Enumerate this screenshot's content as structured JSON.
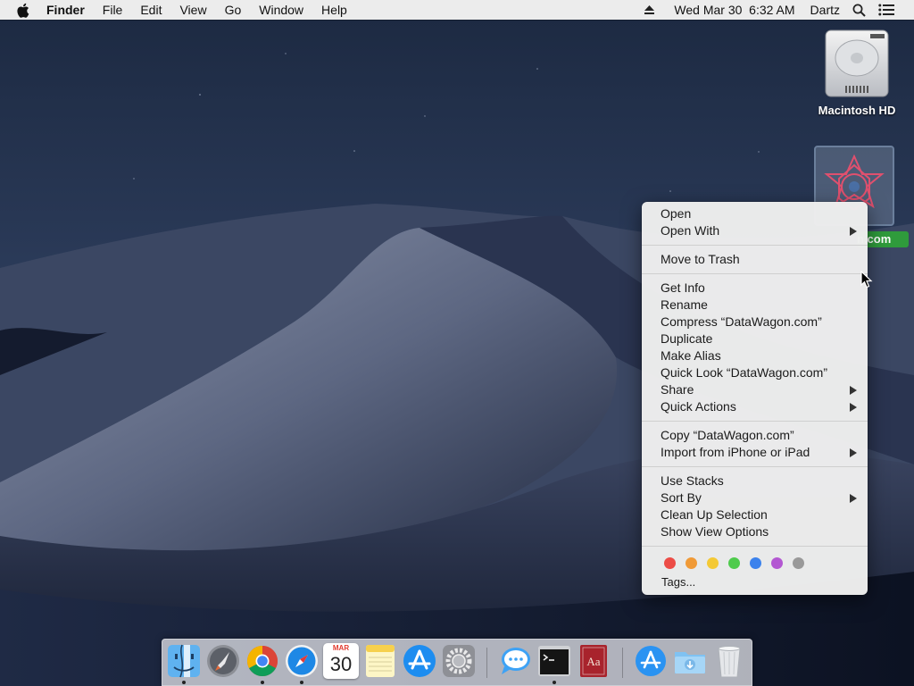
{
  "menubar": {
    "app_name": "Finder",
    "menus": [
      "File",
      "Edit",
      "View",
      "Go",
      "Window",
      "Help"
    ],
    "clock": "Wed Mar 30  6:32 AM",
    "user": "Dartz"
  },
  "desktop": {
    "hd_label": "Macintosh HD",
    "selected_label": "n.com"
  },
  "context_menu": {
    "groups": [
      [
        {
          "label": "Open"
        },
        {
          "label": "Open With",
          "submenu": true
        }
      ],
      [
        {
          "label": "Move to Trash"
        }
      ],
      [
        {
          "label": "Get Info"
        },
        {
          "label": "Rename"
        },
        {
          "label": "Compress “DataWagon.com”"
        },
        {
          "label": "Duplicate"
        },
        {
          "label": "Make Alias"
        },
        {
          "label": "Quick Look “DataWagon.com”"
        },
        {
          "label": "Share",
          "submenu": true
        },
        {
          "label": "Quick Actions",
          "submenu": true
        }
      ],
      [
        {
          "label": "Copy “DataWagon.com”"
        },
        {
          "label": "Import from iPhone or iPad",
          "submenu": true
        }
      ],
      [
        {
          "label": "Use Stacks"
        },
        {
          "label": "Sort By",
          "submenu": true
        },
        {
          "label": "Clean Up Selection"
        },
        {
          "label": "Show View Options"
        }
      ]
    ],
    "tag_colors": [
      "#ec4c46",
      "#f09a37",
      "#f4c935",
      "#4ecb4c",
      "#3b82ec",
      "#b357d2",
      "#999999"
    ],
    "tags_label": "Tags..."
  },
  "dock": {
    "calendar_month": "MAR",
    "calendar_day": "30",
    "apps": [
      {
        "name": "finder",
        "running": true
      },
      {
        "name": "launchpad",
        "running": false
      },
      {
        "name": "chrome",
        "running": true
      },
      {
        "name": "safari",
        "running": true
      },
      {
        "name": "calendar",
        "running": false
      },
      {
        "name": "notes",
        "running": false
      },
      {
        "name": "app-store",
        "running": false
      },
      {
        "name": "system-preferences",
        "running": false
      },
      {
        "name": "messages",
        "running": false
      },
      {
        "name": "terminal",
        "running": true
      },
      {
        "name": "dictionary",
        "running": false
      },
      {
        "name": "app-store-downloads",
        "running": false
      },
      {
        "name": "downloads",
        "running": false
      },
      {
        "name": "trash",
        "running": false
      }
    ]
  }
}
